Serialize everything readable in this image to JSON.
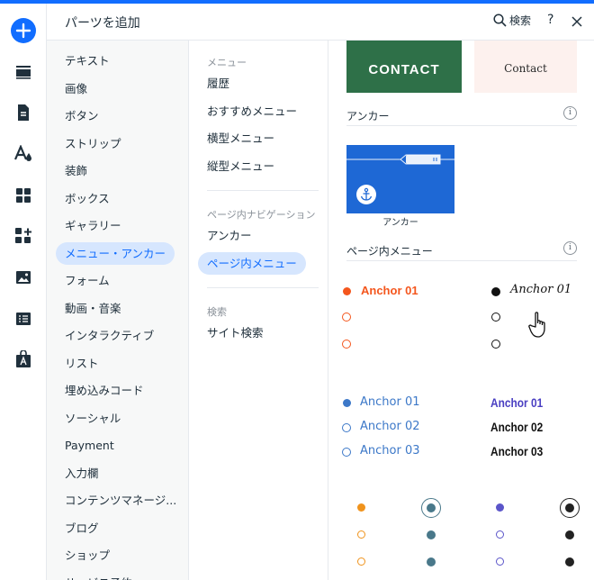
{
  "header": {
    "title": "パーツを追加",
    "search_label": "検索",
    "help_label": "?"
  },
  "rail": {
    "items": [
      {
        "icon": "add-icon"
      },
      {
        "icon": "sections-icon"
      },
      {
        "icon": "pages-icon"
      },
      {
        "icon": "design-icon"
      },
      {
        "icon": "apps-icon"
      },
      {
        "icon": "add-apps-icon"
      },
      {
        "icon": "media-icon"
      },
      {
        "icon": "cms-icon"
      },
      {
        "icon": "business-icon"
      }
    ]
  },
  "categories": [
    "テキスト",
    "画像",
    "ボタン",
    "ストリップ",
    "装飾",
    "ボックス",
    "ギャラリー",
    "メニュー・アンカー",
    "フォーム",
    "動画・音楽",
    "インタラクティブ",
    "リスト",
    "埋め込みコード",
    "ソーシャル",
    "Payment",
    "入力欄",
    "コンテンツマネージ...",
    "ブログ",
    "ショップ",
    "サービス予約"
  ],
  "selected_category": "メニュー・アンカー",
  "subcategories": {
    "menu_section": "メニュー",
    "menu_items": [
      "履歴",
      "おすすめメニュー",
      "横型メニュー",
      "縦型メニュー"
    ],
    "nav_section": "ページ内ナビゲーション",
    "nav_items": [
      "アンカー",
      "ページ内メニュー"
    ],
    "search_section": "検索",
    "search_items": [
      "サイト検索"
    ],
    "selected": "ページ内メニュー"
  },
  "main": {
    "contact_green_label": "CONTACT",
    "contact_pink_label": "Contact",
    "anchor_section": "アンカー",
    "anchor_tile_caption": "アンカー",
    "page_menu_section": "ページ内メニュー",
    "info_glyph": "i",
    "menu1": {
      "labels": [
        "Anchor 01"
      ]
    },
    "menu2": {
      "labels": [
        "Anchor 01"
      ]
    },
    "menu3": {
      "labels": [
        "Anchor 01",
        "Anchor 02",
        "Anchor 03"
      ]
    },
    "menu4": {
      "labels": [
        "Anchor 01",
        "Anchor 02",
        "Anchor 03"
      ]
    }
  },
  "colors": {
    "accent": "#116dff",
    "contact_green": "#2e7048",
    "contact_pink": "#fdf1ee",
    "anchor_orange": "#f4561d",
    "anchor_blue": "#3c78c8",
    "anchor_purple": "#4a3fc2",
    "anchor_tile_blue": "#1e68d5"
  }
}
